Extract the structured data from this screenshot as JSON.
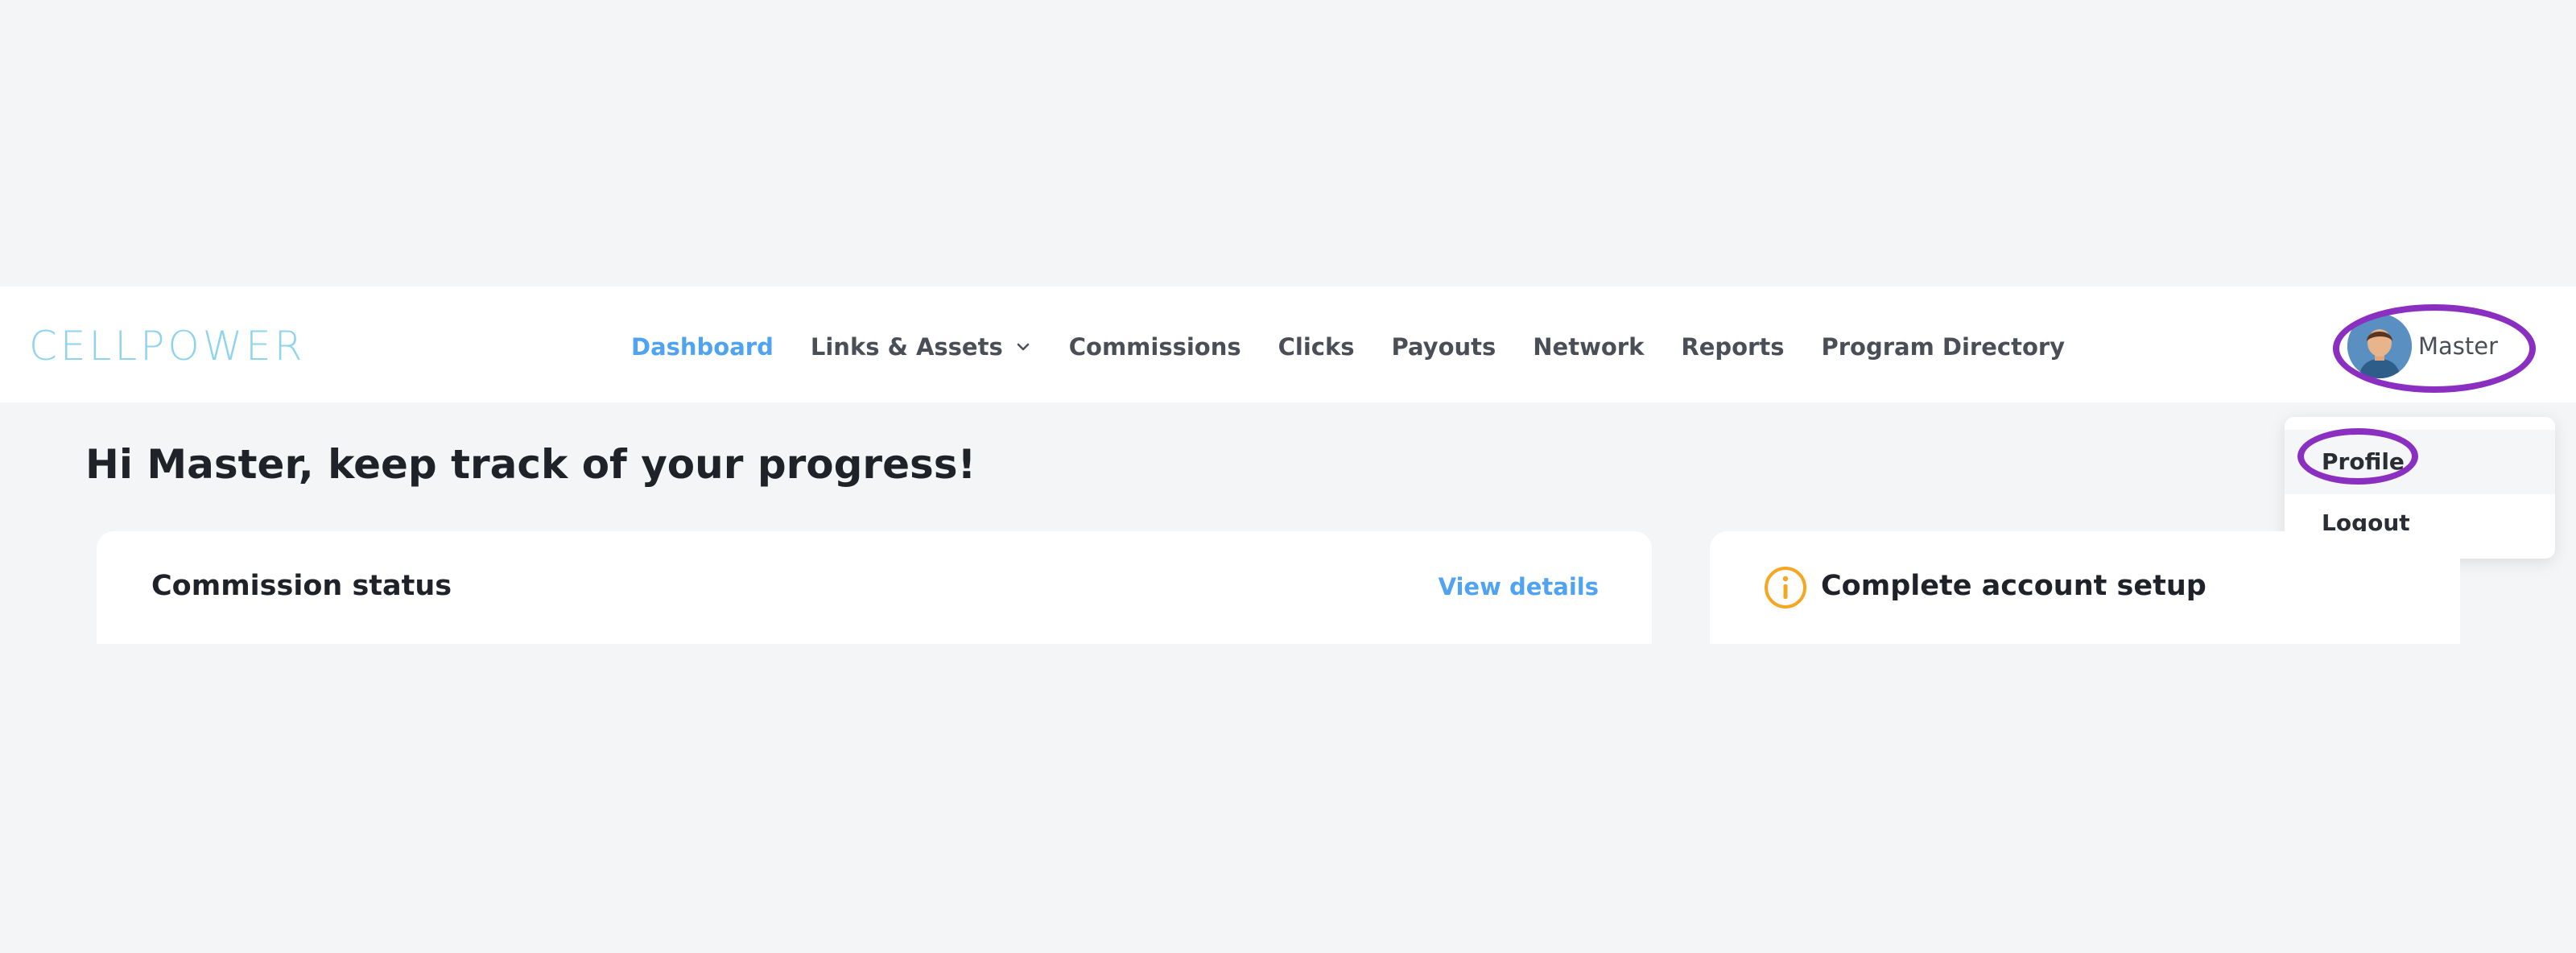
{
  "brand": {
    "logo_text": "CELLPOWER",
    "logo_color": "#8fd3ee"
  },
  "nav": {
    "items": [
      {
        "label": "Dashboard",
        "active": true
      },
      {
        "label": "Links & Assets",
        "has_dropdown": true
      },
      {
        "label": "Commissions"
      },
      {
        "label": "Clicks"
      },
      {
        "label": "Payouts"
      },
      {
        "label": "Network"
      },
      {
        "label": "Reports"
      },
      {
        "label": "Program Directory"
      }
    ]
  },
  "user": {
    "name": "Master",
    "avatar_icon": "user-avatar"
  },
  "dropdown": {
    "items": [
      "Profile",
      "Logout"
    ]
  },
  "greeting": "Hi Master, keep track of your progress!",
  "cards": {
    "commission": {
      "title": "Commission status",
      "link": "View details"
    },
    "setup": {
      "title": "Complete account setup",
      "icon": "info-icon"
    }
  },
  "colors": {
    "accent": "#4fa3f0",
    "highlight": "#8b2fc0",
    "warning": "#f5a623"
  }
}
